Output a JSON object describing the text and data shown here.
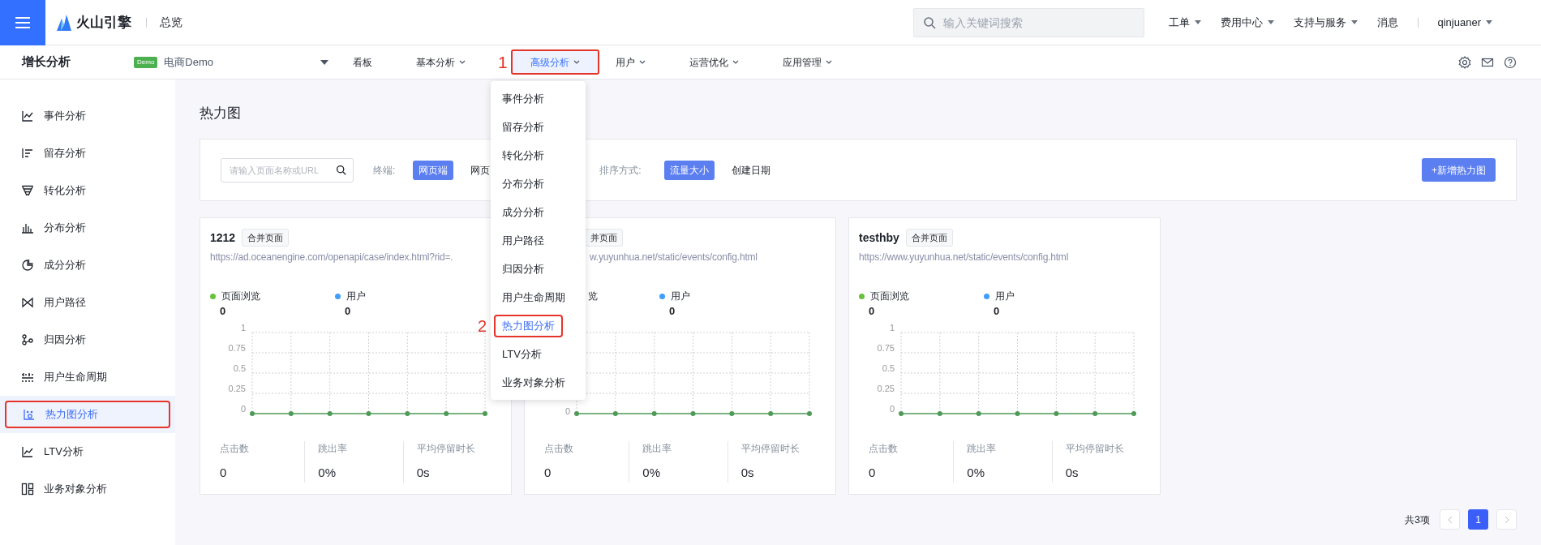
{
  "topbar": {
    "logo": "火山引擎",
    "section": "总览",
    "search": {
      "placeholder": "输入关键词搜索"
    },
    "menus": [
      {
        "label": "工单",
        "dropdown": true
      },
      {
        "label": "费用中心",
        "dropdown": true
      },
      {
        "label": "支持与服务",
        "dropdown": true
      },
      {
        "label": "消息",
        "dropdown": false
      }
    ],
    "user": "qinjuaner"
  },
  "navbar": {
    "product": "增长分析",
    "app_badge": "Demo",
    "app_name": "电商Demo",
    "items": [
      {
        "label": "看板",
        "dropdown": false,
        "selected": false,
        "outlined": false
      },
      {
        "label": "基本分析",
        "dropdown": true,
        "selected": false,
        "outlined": false
      },
      {
        "label": "高级分析",
        "dropdown": true,
        "selected": true,
        "outlined": true,
        "callout": "1"
      },
      {
        "label": "用户",
        "dropdown": true,
        "selected": false,
        "outlined": false
      },
      {
        "label": "运营优化",
        "dropdown": true,
        "selected": false,
        "outlined": false
      },
      {
        "label": "应用管理",
        "dropdown": true,
        "selected": false,
        "outlined": false
      }
    ]
  },
  "dropdown": {
    "items": [
      {
        "label": "事件分析",
        "selected": false,
        "outlined": false
      },
      {
        "label": "留存分析",
        "selected": false,
        "outlined": false
      },
      {
        "label": "转化分析",
        "selected": false,
        "outlined": false
      },
      {
        "label": "分布分析",
        "selected": false,
        "outlined": false
      },
      {
        "label": "成分分析",
        "selected": false,
        "outlined": false
      },
      {
        "label": "用户路径",
        "selected": false,
        "outlined": false
      },
      {
        "label": "归因分析",
        "selected": false,
        "outlined": false
      },
      {
        "label": "用户生命周期",
        "selected": false,
        "outlined": false
      },
      {
        "label": "热力图分析",
        "selected": true,
        "outlined": true,
        "callout": "2"
      },
      {
        "label": "LTV分析",
        "selected": false,
        "outlined": false
      },
      {
        "label": "业务对象分析",
        "selected": false,
        "outlined": false
      }
    ]
  },
  "sidebar": {
    "items": [
      {
        "label": "事件分析",
        "selected": false,
        "outlined": false
      },
      {
        "label": "留存分析",
        "selected": false,
        "outlined": false
      },
      {
        "label": "转化分析",
        "selected": false,
        "outlined": false
      },
      {
        "label": "分布分析",
        "selected": false,
        "outlined": false
      },
      {
        "label": "成分分析",
        "selected": false,
        "outlined": false
      },
      {
        "label": "用户路径",
        "selected": false,
        "outlined": false
      },
      {
        "label": "归因分析",
        "selected": false,
        "outlined": false
      },
      {
        "label": "用户生命周期",
        "selected": false,
        "outlined": false
      },
      {
        "label": "热力图分析",
        "selected": true,
        "outlined": true
      },
      {
        "label": "LTV分析",
        "selected": false,
        "outlined": false
      },
      {
        "label": "业务对象分析",
        "selected": false,
        "outlined": false
      }
    ]
  },
  "page": {
    "title": "热力图",
    "filter": {
      "search_placeholder": "请输入页面名称或URL",
      "terminal_label": "终端:",
      "terminal_options": [
        {
          "label": "网页端",
          "selected": true
        },
        {
          "label": "网页",
          "selected": false
        }
      ],
      "sort_label": "排序方式:",
      "sort_options": [
        {
          "label": "流量大小",
          "selected": true
        },
        {
          "label": "创建日期",
          "selected": false
        }
      ],
      "add_button": "+新增热力图"
    },
    "cards": [
      {
        "title": "1212",
        "badge": "合并页面",
        "url": "https://ad.oceanengine.com/openapi/case/index.html?rid=.",
        "covered": false,
        "legend": [
          {
            "label": "页面浏览",
            "value": "0",
            "color": "#67c23a"
          },
          {
            "label": "用户",
            "value": "0",
            "color": "#409eff"
          }
        ],
        "chart_data": {
          "type": "line",
          "grid": true,
          "ylim": [
            0,
            1
          ],
          "yticks": [
            0,
            0.25,
            0.5,
            0.75,
            1
          ],
          "series": [
            {
              "color": "#4e9a56",
              "marker": true,
              "values": [
                0,
                0,
                0,
                0,
                0,
                0,
                0
              ]
            }
          ]
        },
        "stats": [
          {
            "label": "点击数",
            "value": "0"
          },
          {
            "label": "跳出率",
            "value": "0%"
          },
          {
            "label": "平均停留时长",
            "value": "0s"
          }
        ]
      },
      {
        "badge": "并页面",
        "url": "w.yuyunhua.net/static/events/config.html",
        "covered": true,
        "legend": [
          {
            "label": "览"
          },
          {
            "label": "用户",
            "value": "0",
            "color": "#409eff"
          }
        ],
        "axis_text": [
          "0"
        ],
        "stats": [
          {
            "label": "点击数",
            "value": "0"
          },
          {
            "label": "跳出率",
            "value": "0%"
          },
          {
            "label": "平均停留时长",
            "value": "0s"
          }
        ]
      },
      {
        "title": "testhby",
        "badge": "合并页面",
        "url": "https://www.yuyunhua.net/static/events/config.html",
        "covered": false,
        "legend": [
          {
            "label": "页面浏览",
            "value": "0",
            "color": "#67c23a"
          },
          {
            "label": "用户",
            "value": "0",
            "color": "#409eff"
          }
        ],
        "chart_data": {
          "type": "line",
          "grid": true,
          "ylim": [
            0,
            1
          ],
          "yticks": [
            0,
            0.25,
            0.5,
            0.75,
            1
          ],
          "series": [
            {
              "color": "#4e9a56",
              "marker": true,
              "values": [
                0,
                0,
                0,
                0,
                0,
                0,
                0
              ]
            }
          ]
        },
        "stats": [
          {
            "label": "点击数",
            "value": "0"
          },
          {
            "label": "跳出率",
            "value": "0%"
          },
          {
            "label": "平均停留时长",
            "value": "0s"
          }
        ]
      }
    ],
    "pagination": {
      "total": "共3项",
      "pages": [
        {
          "label": "1",
          "selected": true
        }
      ]
    }
  }
}
